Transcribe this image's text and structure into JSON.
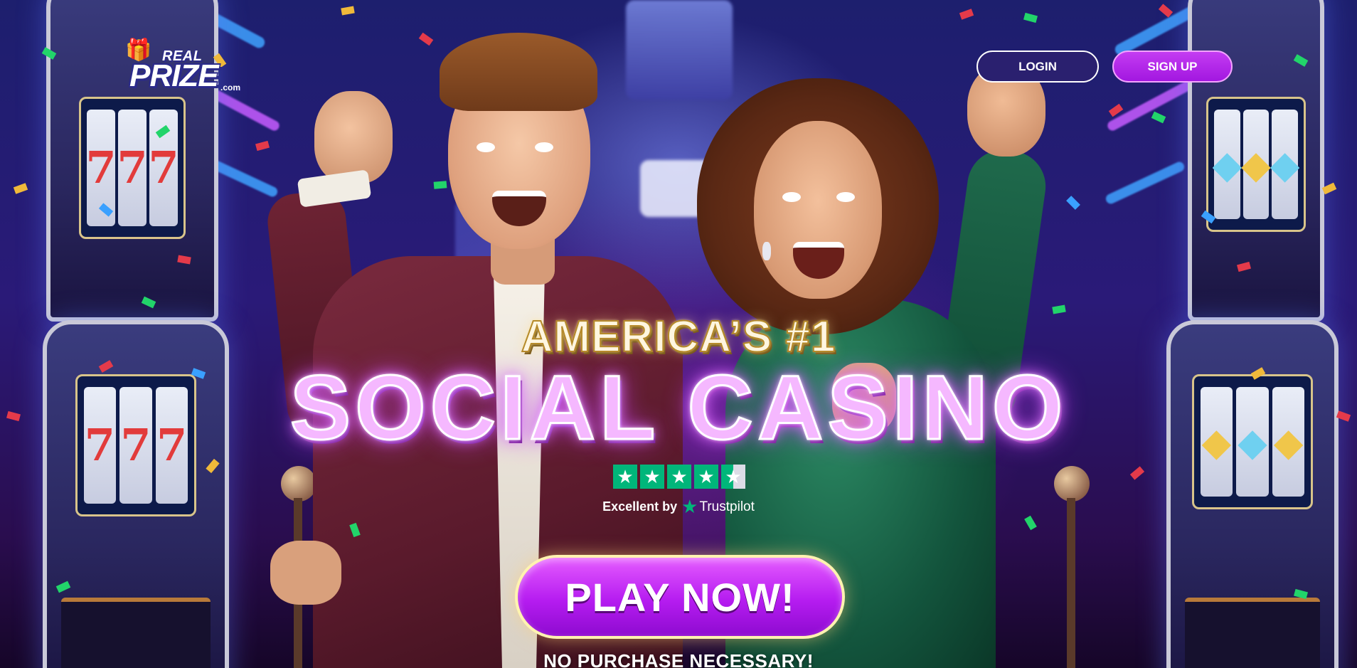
{
  "brand": {
    "logo_top": "REAL",
    "logo_main": "PRIZE",
    "logo_suffix": ".com"
  },
  "header": {
    "login_label": "LOGIN",
    "signup_label": "SIGN UP"
  },
  "hero": {
    "tagline": "AMERICA’S #1",
    "headline": "SOCIAL CASINO",
    "trust": {
      "rating_text": "Excellent by",
      "brand": "Trustpilot",
      "stars": 4.5,
      "star_color": "#00b67a"
    },
    "cta_label": "PLAY NOW!",
    "disclaimer": "NO PURCHASE NECESSARY!"
  },
  "colors": {
    "accent": "#b51cf0",
    "login_bg": "#2a206f",
    "headline_glow": "#e17bff"
  }
}
